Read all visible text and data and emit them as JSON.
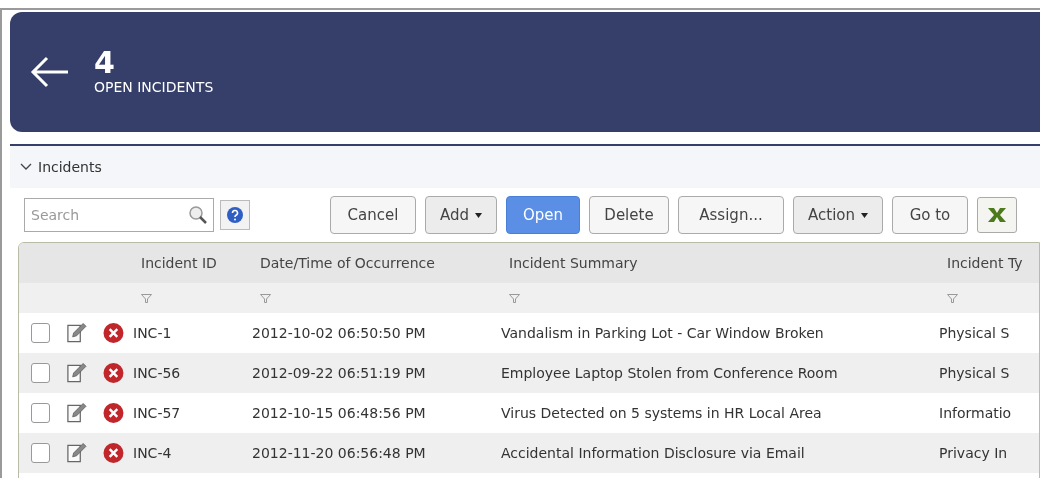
{
  "header": {
    "count": "4",
    "title": "OPEN INCIDENTS"
  },
  "section": {
    "title": "Incidents",
    "expanded": true
  },
  "search": {
    "placeholder": "Search"
  },
  "buttons": [
    {
      "label": "Cancel",
      "kind": "plain"
    },
    {
      "label": "Add",
      "kind": "dropdown"
    },
    {
      "label": "Open",
      "kind": "primary"
    },
    {
      "label": "Delete",
      "kind": "plain"
    },
    {
      "label": "Assign...",
      "kind": "plain"
    },
    {
      "label": "Action",
      "kind": "dropdown"
    },
    {
      "label": "Go to",
      "kind": "plain"
    }
  ],
  "table": {
    "columns": [
      "Incident ID",
      "Date/Time of Occurrence",
      "Incident Summary",
      "Incident Ty"
    ],
    "rows": [
      {
        "checked": false,
        "cells": [
          "INC-1",
          "2012-10-02 06:50:50 PM",
          "Vandalism in Parking Lot - Car Window Broken",
          "Physical S"
        ]
      },
      {
        "checked": false,
        "cells": [
          "INC-56",
          "2012-09-22 06:51:19 PM",
          "Employee Laptop Stolen from Conference Room",
          "Physical S"
        ]
      },
      {
        "checked": false,
        "cells": [
          "INC-57",
          "2012-10-15 06:48:56 PM",
          "Virus Detected on 5 systems in HR Local Area",
          "Informatio"
        ]
      },
      {
        "checked": false,
        "cells": [
          "INC-4",
          "2012-11-20 06:56:48 PM",
          "Accidental Information Disclosure via Email",
          "Privacy In"
        ]
      }
    ]
  }
}
